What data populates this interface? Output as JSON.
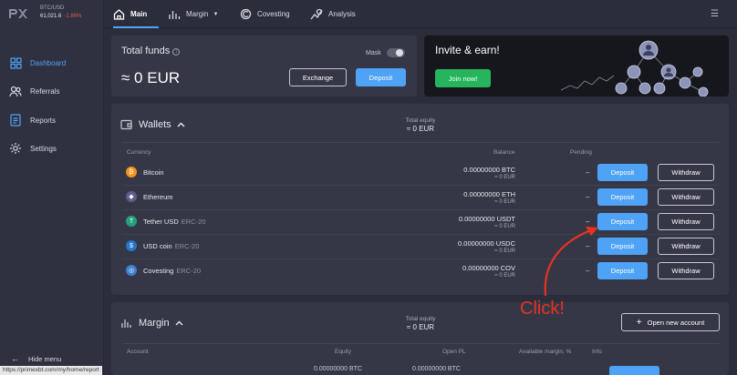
{
  "ticker": {
    "pair": "BTC/USD",
    "price": "61,021.6",
    "change": "-1.86%"
  },
  "sidebar": {
    "items": [
      {
        "label": "Dashboard",
        "icon": "dashboard-icon",
        "active": true
      },
      {
        "label": "Referrals",
        "icon": "users-icon",
        "active": false
      },
      {
        "label": "Reports",
        "icon": "reports-icon",
        "active": false
      },
      {
        "label": "Settings",
        "icon": "gear-icon",
        "active": false
      }
    ],
    "hide_menu": "Hide menu"
  },
  "status_url": "https://primexbt.com/my/home/report",
  "topbar": {
    "tabs": [
      {
        "label": "Main",
        "icon": "home-icon"
      },
      {
        "label": "Margin",
        "icon": "chart-icon"
      },
      {
        "label": "Covesting",
        "icon": "covesting-icon"
      },
      {
        "label": "Analysis",
        "icon": "analysis-icon"
      }
    ]
  },
  "funds": {
    "title": "Total funds",
    "amount": "≈ 0 EUR",
    "mask_label": "Mask",
    "exchange": "Exchange",
    "deposit": "Deposit"
  },
  "invite": {
    "title": "Invite & earn!",
    "button": "Join now!"
  },
  "wallets": {
    "title": "Wallets",
    "equity_label": "Total equity",
    "equity_value": "≈ 0 EUR",
    "headers": {
      "currency": "Currency",
      "balance": "Balance",
      "pending": "Pending"
    },
    "deposit": "Deposit",
    "withdraw": "Withdraw",
    "rows": [
      {
        "name": "Bitcoin",
        "sub": "",
        "balance": "0.00000000 BTC",
        "eur": "≈ 0 EUR",
        "pending": "–",
        "color": "#f7931a",
        "glyph": "₿"
      },
      {
        "name": "Ethereum",
        "sub": "",
        "balance": "0.00000000 ETH",
        "eur": "≈ 0 EUR",
        "pending": "–",
        "color": "#5a5f8c",
        "glyph": "◆"
      },
      {
        "name": "Tether USD",
        "sub": "ERC-20",
        "balance": "0.00000000 USDT",
        "eur": "≈ 0 EUR",
        "pending": "–",
        "color": "#26a17b",
        "glyph": "T"
      },
      {
        "name": "USD coin",
        "sub": "ERC-20",
        "balance": "0.00000000 USDC",
        "eur": "≈ 0 EUR",
        "pending": "–",
        "color": "#2775ca",
        "glyph": "$"
      },
      {
        "name": "Covesting",
        "sub": "ERC-20",
        "balance": "0.00000000 COV",
        "eur": "≈ 0 EUR",
        "pending": "–",
        "color": "#3d7fd1",
        "glyph": "◎"
      }
    ]
  },
  "margin": {
    "title": "Margin",
    "equity_label": "Total equity",
    "equity_value": "≈ 0 EUR",
    "open_account": "Open new account",
    "headers": {
      "account": "Account",
      "equity": "Equity",
      "open_pl": "Open PL",
      "available": "Available margin, %",
      "info": "Info"
    },
    "row_equity": "0.00000000 BTC",
    "row_open_pl": "0.00000000 BTC"
  },
  "annotation": {
    "text": "Click!",
    "color": "#e8321f"
  }
}
